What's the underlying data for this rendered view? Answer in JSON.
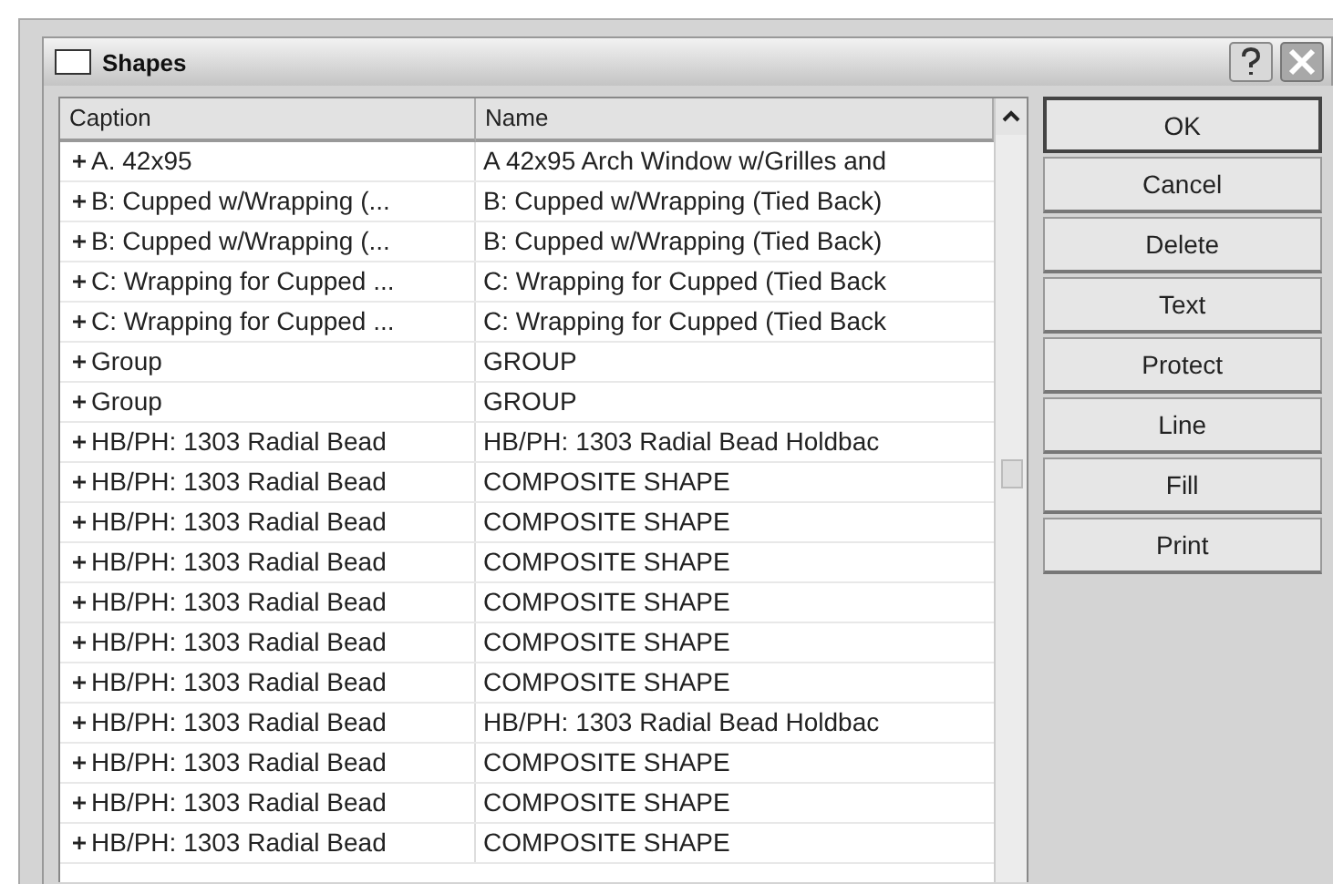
{
  "window": {
    "title": "Shapes"
  },
  "table": {
    "columns": [
      "Caption",
      "Name"
    ],
    "rows": [
      {
        "caption": "A. 42x95",
        "name": "A 42x95  Arch Window w/Grilles and"
      },
      {
        "caption": "B: Cupped w/Wrapping (...",
        "name": "B: Cupped w/Wrapping (Tied Back)"
      },
      {
        "caption": "B: Cupped w/Wrapping (...",
        "name": "B: Cupped w/Wrapping (Tied Back)"
      },
      {
        "caption": "C: Wrapping for Cupped ...",
        "name": "C: Wrapping for Cupped (Tied Back"
      },
      {
        "caption": "C: Wrapping for Cupped ...",
        "name": "C: Wrapping for Cupped (Tied Back"
      },
      {
        "caption": "Group",
        "name": "GROUP"
      },
      {
        "caption": "Group",
        "name": "GROUP"
      },
      {
        "caption": "HB/PH: 1303 Radial Bead",
        "name": "HB/PH: 1303 Radial Bead  Holdbac"
      },
      {
        "caption": "HB/PH: 1303 Radial Bead",
        "name": "COMPOSITE SHAPE"
      },
      {
        "caption": "HB/PH: 1303 Radial Bead",
        "name": "COMPOSITE SHAPE"
      },
      {
        "caption": "HB/PH: 1303 Radial Bead",
        "name": "COMPOSITE SHAPE"
      },
      {
        "caption": "HB/PH: 1303 Radial Bead",
        "name": "COMPOSITE SHAPE"
      },
      {
        "caption": "HB/PH: 1303 Radial Bead",
        "name": "COMPOSITE SHAPE"
      },
      {
        "caption": "HB/PH: 1303 Radial Bead",
        "name": "COMPOSITE SHAPE"
      },
      {
        "caption": "HB/PH: 1303 Radial Bead",
        "name": "HB/PH: 1303 Radial Bead  Holdbac"
      },
      {
        "caption": "HB/PH: 1303 Radial Bead",
        "name": "COMPOSITE SHAPE"
      },
      {
        "caption": "HB/PH: 1303 Radial Bead",
        "name": "COMPOSITE SHAPE"
      },
      {
        "caption": "HB/PH: 1303 Radial Bead",
        "name": "COMPOSITE SHAPE"
      }
    ]
  },
  "buttons": [
    {
      "label": "OK",
      "default": true
    },
    {
      "label": "Cancel",
      "default": false
    },
    {
      "label": "Delete",
      "default": false
    },
    {
      "label": "Text",
      "default": false
    },
    {
      "label": "Protect",
      "default": false
    },
    {
      "label": "Line",
      "default": false
    },
    {
      "label": "Fill",
      "default": false
    },
    {
      "label": "Print",
      "default": false
    }
  ]
}
